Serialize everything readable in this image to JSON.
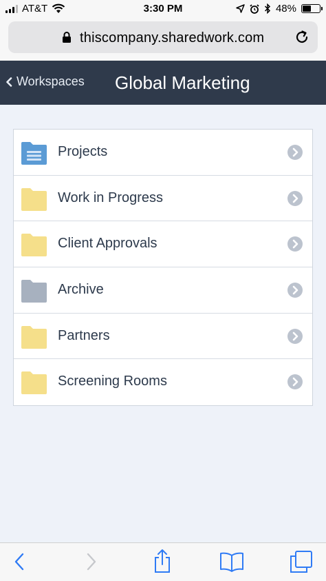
{
  "status_bar": {
    "carrier": "AT&T",
    "time": "3:30 PM",
    "battery": "48%",
    "battery_level": 0.48
  },
  "browser": {
    "url": "thiscompany.sharedwork.com"
  },
  "header": {
    "back_label": "Workspaces",
    "title": "Global Marketing"
  },
  "folders": [
    {
      "name": "Projects",
      "icon": "folder-blue-icon",
      "color": "#5b9bd5"
    },
    {
      "name": "Work in Progress",
      "icon": "folder-yellow-icon",
      "color": "#f5df8a"
    },
    {
      "name": "Client Approvals",
      "icon": "folder-yellow-icon",
      "color": "#f5df8a"
    },
    {
      "name": "Archive",
      "icon": "folder-gray-icon",
      "color": "#a7b1bf"
    },
    {
      "name": "Partners",
      "icon": "folder-yellow-icon",
      "color": "#f5df8a"
    },
    {
      "name": "Screening Rooms",
      "icon": "folder-yellow-icon",
      "color": "#f5df8a"
    }
  ],
  "colors": {
    "header_bg": "#2f3a4b",
    "page_bg": "#eef2f9",
    "ios_blue": "#2f7bf5"
  }
}
